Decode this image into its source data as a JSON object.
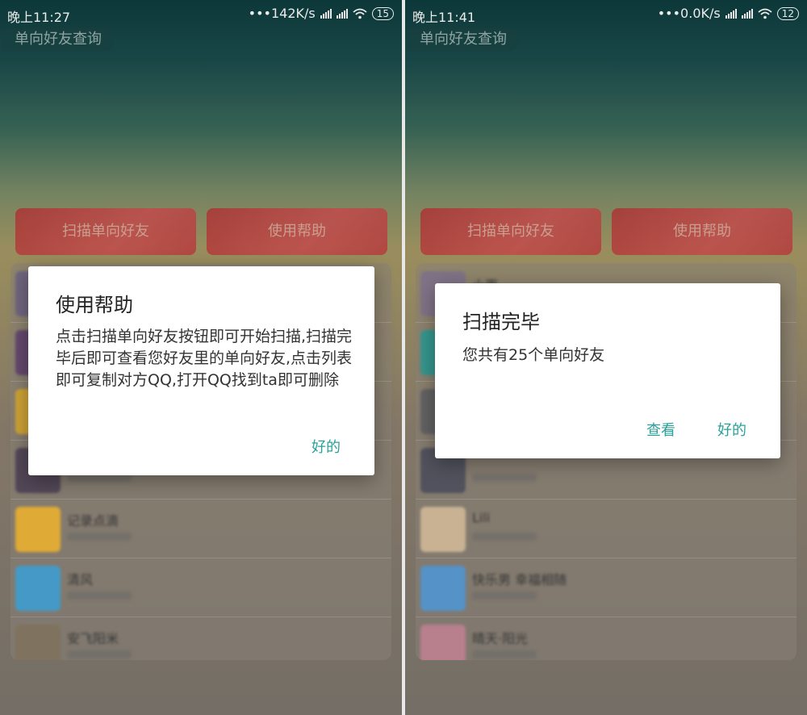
{
  "left": {
    "status": {
      "time": "晚上11:27",
      "speed": "•••142K/s",
      "battery": "15"
    },
    "app_title": "单向好友查询",
    "buttons": {
      "scan": "扫描单向好友",
      "help": "使用帮助"
    },
    "list": {
      "rows": [
        {
          "name": "",
          "avatar_color": "#7a6e8a"
        },
        {
          "name": "",
          "avatar_color": "#6e4f77"
        },
        {
          "name": "",
          "avatar_color": "#e0b13a"
        },
        {
          "name": "",
          "avatar_color": "#5a4e5f"
        },
        {
          "name": "记录点滴",
          "avatar_color": "#f3b93b"
        },
        {
          "name": "清风",
          "avatar_color": "#4aa7d8"
        },
        {
          "name": "安飞阳米",
          "avatar_color": "#8a7c66"
        }
      ]
    },
    "dialog": {
      "title": "使用帮助",
      "body": "点击扫描单向好友按钮即可开始扫描,扫描完毕后即可查看您好友里的单向好友,点击列表即可复制对方QQ,打开QQ找到ta即可删除",
      "ok": "好的"
    }
  },
  "right": {
    "status": {
      "time": "晚上11:41",
      "speed": "•••0.0K/s",
      "battery": "12"
    },
    "app_title": "单向好友查询",
    "buttons": {
      "scan": "扫描单向好友",
      "help": "使用帮助"
    },
    "list": {
      "rows": [
        {
          "name": "小雨",
          "avatar_color": "#8c7d93"
        },
        {
          "name": "",
          "avatar_color": "#3aa39a"
        },
        {
          "name": "",
          "avatar_color": "#6b6b6b"
        },
        {
          "name": "",
          "avatar_color": "#5a5a66"
        },
        {
          "name": "Lili",
          "avatar_color": "#d9c2a0"
        },
        {
          "name": "快乐男 幸福相随",
          "avatar_color": "#5c9fd8"
        },
        {
          "name": "晴天·阳光",
          "avatar_color": "#c88a9a"
        }
      ]
    },
    "dialog": {
      "title": "扫描完毕",
      "body": "您共有25个单向好友",
      "view": "查看",
      "ok": "好的"
    }
  },
  "colors": {
    "accent": "#2aa198",
    "button_red": "#c94545"
  }
}
